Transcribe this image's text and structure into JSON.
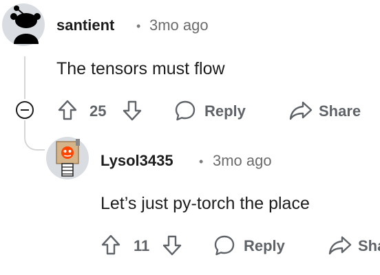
{
  "comment": {
    "username": "santient",
    "separator": "•",
    "time": "3mo ago",
    "body": "The tensors must flow",
    "votes": "25",
    "reply_label": "Reply",
    "share_label": "Share"
  },
  "reply": {
    "username": "Lysol3435",
    "separator": "•",
    "time": "3mo ago",
    "body": "Let’s just py-torch the place",
    "votes": "11",
    "reply_label": "Reply",
    "share_label": "Share"
  },
  "icons": {
    "upvote": "upvote-arrow-icon",
    "downvote": "downvote-arrow-icon",
    "reply": "speech-bubble-icon",
    "share": "share-arrow-icon",
    "collapse": "collapse-minus-icon"
  },
  "colors": {
    "text": "#1c1c1c",
    "muted": "#5f6368",
    "line": "#d6d6d6"
  }
}
